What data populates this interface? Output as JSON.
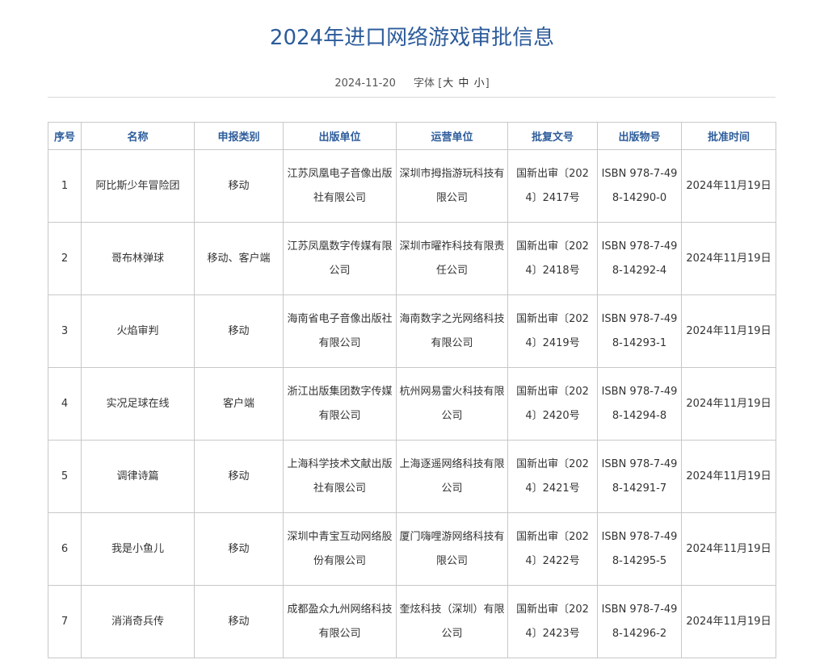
{
  "page": {
    "title": "2024年进口网络游戏审批信息",
    "date": "2024-11-20",
    "font_size_label": "字体",
    "font_open": "[",
    "font_close": "]",
    "font_large": "大",
    "font_medium": "中",
    "font_small": "小"
  },
  "table": {
    "headers": [
      "序号",
      "名称",
      "申报类别",
      "出版单位",
      "运营单位",
      "批复文号",
      "出版物号",
      "批准时间"
    ],
    "rows": [
      [
        "1",
        "阿比斯少年冒险团",
        "移动",
        "江苏凤凰电子音像出版社有限公司",
        "深圳市拇指游玩科技有限公司",
        "国新出审〔2024〕2417号",
        "ISBN 978-7-498-14290-0",
        "2024年11月19日"
      ],
      [
        "2",
        "哥布林弹球",
        "移动、客户端",
        "江苏凤凰数字传媒有限公司",
        "深圳市曜祚科技有限责任公司",
        "国新出审〔2024〕2418号",
        "ISBN 978-7-498-14292-4",
        "2024年11月19日"
      ],
      [
        "3",
        "火焰审判",
        "移动",
        "海南省电子音像出版社有限公司",
        "海南数字之光网络科技有限公司",
        "国新出审〔2024〕2419号",
        "ISBN 978-7-498-14293-1",
        "2024年11月19日"
      ],
      [
        "4",
        "实况足球在线",
        "客户端",
        "浙江出版集团数字传媒有限公司",
        "杭州网易雷火科技有限公司",
        "国新出审〔2024〕2420号",
        "ISBN 978-7-498-14294-8",
        "2024年11月19日"
      ],
      [
        "5",
        "调律诗篇",
        "移动",
        "上海科学技术文献出版社有限公司",
        "上海逐遥网络科技有限公司",
        "国新出审〔2024〕2421号",
        "ISBN 978-7-498-14291-7",
        "2024年11月19日"
      ],
      [
        "6",
        "我是小鱼儿",
        "移动",
        "深圳中青宝互动网络股份有限公司",
        "厦门嗨哩游网络科技有限公司",
        "国新出审〔2024〕2422号",
        "ISBN 978-7-498-14295-5",
        "2024年11月19日"
      ],
      [
        "7",
        "消消奇兵传",
        "移动",
        "成都盈众九州网络科技有限公司",
        "奎炫科技（深圳）有限公司",
        "国新出审〔2024〕2423号",
        "ISBN 978-7-498-14296-2",
        "2024年11月19日"
      ]
    ]
  }
}
